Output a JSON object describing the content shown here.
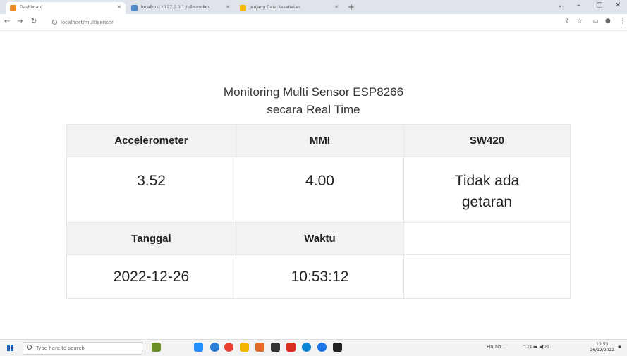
{
  "browser": {
    "tabs": [
      {
        "label": "Dashboard",
        "favicon_color": "#f28b25",
        "active": true
      },
      {
        "label": "localhost / 127.0.0.1 / dbsmokes",
        "favicon_color": "#4e88c7",
        "active": false
      },
      {
        "label": "Jenjang Data Kesehatan",
        "favicon_color": "#f4b400",
        "active": false
      }
    ],
    "new_tab_label": "+",
    "url": "localhost/multisensor"
  },
  "page": {
    "title_line1": "Monitoring Multi Sensor ESP8266",
    "title_line2": "secara Real Time",
    "headers": {
      "accelerometer": "Accelerometer",
      "mmi": "MMI",
      "sw420": "SW420",
      "tanggal": "Tanggal",
      "waktu": "Waktu"
    },
    "values": {
      "accelerometer": "3.52",
      "mmi": "4.00",
      "sw420": "Tidak ada getaran",
      "tanggal": "2022-12-26",
      "waktu": "10:53:12"
    }
  },
  "taskbar": {
    "search_placeholder": "Type here to search",
    "weather": "Hujan...",
    "clock_time": "10:53",
    "clock_date": "26/12/2022",
    "app_icon_colors": [
      "#6b8e23",
      "#1e90ff",
      "#2a7fd4",
      "#e94235",
      "#f4b400",
      "#e06c2a",
      "#333333",
      "#d93025",
      "#0a84d6",
      "#1a73e8",
      "#222222"
    ]
  }
}
